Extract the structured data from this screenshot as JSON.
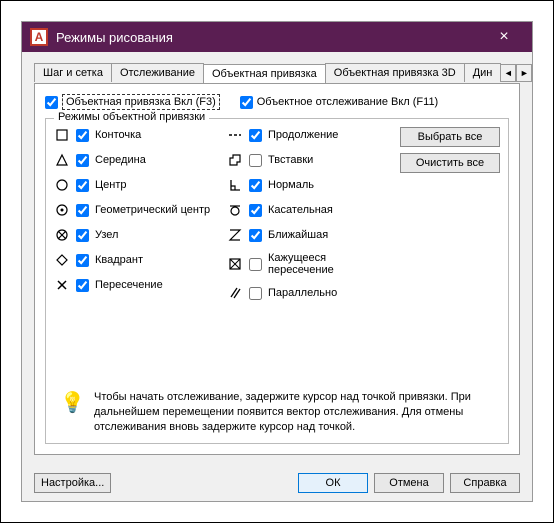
{
  "window": {
    "title": "Режимы рисования"
  },
  "tabs": {
    "items": [
      "Шаг и сетка",
      "Отслеживание",
      "Объектная привязка",
      "Объектная привязка 3D",
      "Дин"
    ],
    "active_index": 2
  },
  "top": {
    "osnap_on": "Объектная привязка Вкл (F3)",
    "otrack_on": "Объектное отслеживание Вкл (F11)"
  },
  "fieldset": {
    "legend": "Режимы объектной привязки"
  },
  "buttons": {
    "select_all": "Выбрать все",
    "clear_all": "Очистить все",
    "settings": "Настройка...",
    "ok": "ОК",
    "cancel": "Отмена",
    "help": "Справка"
  },
  "snaps_left": [
    {
      "id": "endpoint",
      "label": "Конточка",
      "checked": true
    },
    {
      "id": "midpoint",
      "label": "Середина",
      "checked": true
    },
    {
      "id": "center",
      "label": "Центр",
      "checked": true
    },
    {
      "id": "geocenter",
      "label": "Геометрический центр",
      "checked": true
    },
    {
      "id": "node",
      "label": "Узел",
      "checked": true
    },
    {
      "id": "quadrant",
      "label": "Квадрант",
      "checked": true
    },
    {
      "id": "intersection",
      "label": "Пересечение",
      "checked": true
    }
  ],
  "snaps_right": [
    {
      "id": "extension",
      "label": "Продолжение",
      "checked": true
    },
    {
      "id": "insertion",
      "label": "Твставки",
      "checked": false
    },
    {
      "id": "perpendicular",
      "label": "Нормаль",
      "checked": true
    },
    {
      "id": "tangent",
      "label": "Касательная",
      "checked": true
    },
    {
      "id": "nearest",
      "label": "Ближайшая",
      "checked": true
    },
    {
      "id": "apparent",
      "label": "Кажущееся пересечение",
      "checked": false
    },
    {
      "id": "parallel",
      "label": "Параллельно",
      "checked": false
    }
  ],
  "hint": "Чтобы начать отслеживание, задержите курсор над точкой привязки. При дальнейшем перемещении появится вектор отслеживания. Для отмены отслеживания вновь задержите курсор над точкой."
}
